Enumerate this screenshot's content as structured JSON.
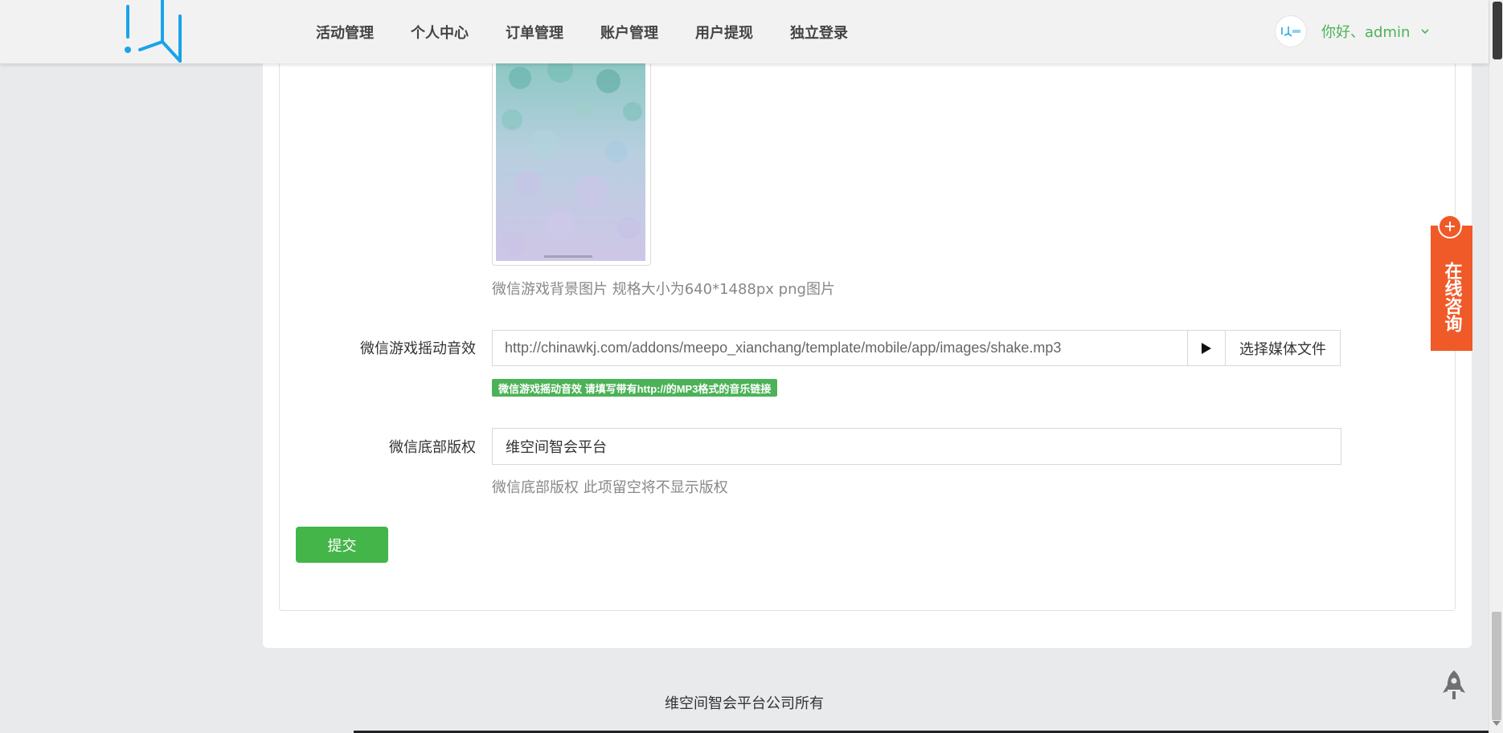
{
  "header": {
    "nav": [
      "活动管理",
      "个人中心",
      "订单管理",
      "账户管理",
      "用户提现",
      "独立登录"
    ],
    "greeting": "你好、admin"
  },
  "form": {
    "bg_image_help": "微信游戏背景图片 规格大小为640*1488px png图片",
    "shake_sound": {
      "label": "微信游戏摇动音效",
      "value": "http://chinawkj.com/addons/meepo_xianchang/template/mobile/app/images/shake.mp3",
      "media_button": "选择媒体文件",
      "tag": "微信游戏摇动音效 请填写带有http://的MP3格式的音乐链接"
    },
    "copyright": {
      "label": "微信底部版权",
      "value": "维空间智会平台",
      "help": "微信底部版权 此项留空将不显示版权"
    },
    "submit_label": "提交"
  },
  "consult_label": "在线咨询",
  "footer": {
    "text": "维空间智会平台公司所有"
  },
  "colors": {
    "accent_green": "#4cb257",
    "consult_orange": "#f05a28",
    "logo_blue": "#1aa3e8"
  }
}
